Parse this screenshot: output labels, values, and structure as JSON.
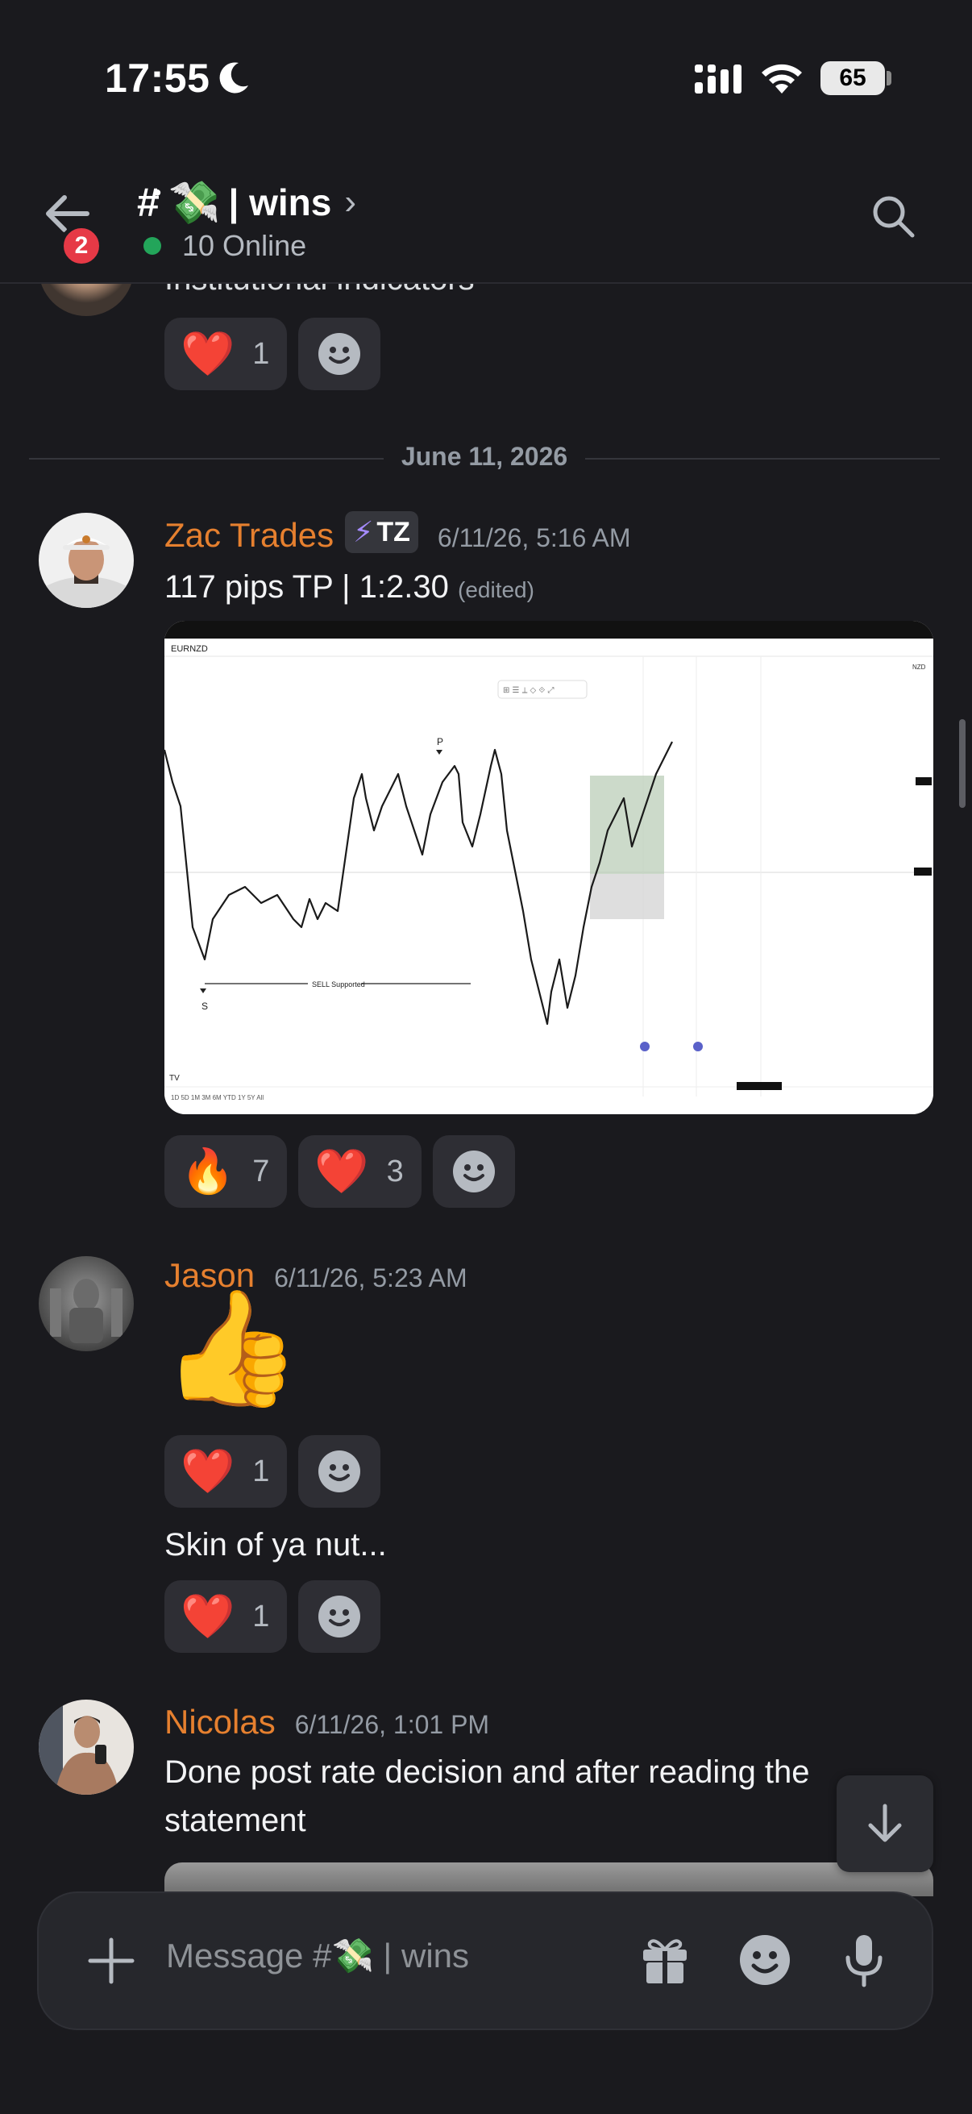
{
  "status_bar": {
    "time": "17:55",
    "battery": "65"
  },
  "header": {
    "back_badge_count": "2",
    "channel_hash": "#",
    "channel_emoji": "💸",
    "channel_name": "| wins",
    "online_text": "10 Online"
  },
  "messages": {
    "partial": {
      "text": "Institutional indicators",
      "reactions": [
        {
          "emoji": "❤️",
          "count": "1"
        }
      ]
    },
    "date_divider": "June 11, 2026",
    "zac": {
      "username": "Zac Trades",
      "tag": "TZ",
      "timestamp": "6/11/26, 5:16 AM",
      "text": "117 pips TP | 1:2.30",
      "edited": "(edited)",
      "reactions": [
        {
          "emoji": "🔥",
          "count": "7"
        },
        {
          "emoji": "❤️",
          "count": "3"
        }
      ],
      "chart_symbol": "EURNZD",
      "chart_label": "SELL Supported",
      "chart_tick_right": "NZD"
    },
    "jason": {
      "username": "Jason",
      "timestamp": "6/11/26, 5:23 AM",
      "emoji": "👍",
      "reactions_1": [
        {
          "emoji": "❤️",
          "count": "1"
        }
      ],
      "text": "Skin of ya nut...",
      "reactions_2": [
        {
          "emoji": "❤️",
          "count": "1"
        }
      ]
    },
    "nicolas": {
      "username": "Nicolas",
      "timestamp": "6/11/26, 1:01 PM",
      "text_line1": "Done post rate decision and after reading the",
      "text_line2": "statement"
    }
  },
  "composer": {
    "placeholder": "Message #💸 | wins"
  },
  "colors": {
    "background": "#1a1a1e",
    "username": "#e6802f",
    "badge": "#e63946",
    "online": "#23a55a"
  }
}
